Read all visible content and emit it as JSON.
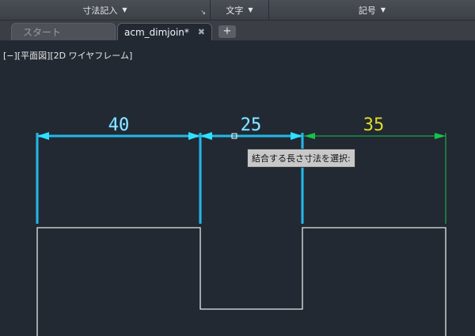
{
  "ribbon": {
    "panels": [
      {
        "label": "寸法記入",
        "has_dropdown": true,
        "has_launcher": true
      },
      {
        "label": "文字",
        "has_dropdown": true,
        "has_launcher": false
      },
      {
        "label": "記号",
        "has_dropdown": true,
        "has_launcher": false
      }
    ]
  },
  "tabs": {
    "start_label": "スタート",
    "active_label": "acm_dimjoin*",
    "close_symbol": "✖",
    "add_symbol": "+"
  },
  "viewport": {
    "label": "[−][平面図][2D ワイヤフレーム]"
  },
  "dimensions": {
    "d1": "40",
    "d2": "25",
    "d3": "35"
  },
  "tooltip": {
    "text": "結合する長さ寸法を選択:"
  },
  "colors": {
    "background": "#222932",
    "selected_dimension": "#1fa0d6",
    "dimension_green": "#17c44a",
    "dimension_text_yellow": "#e0dc2a",
    "geometry": "#e8e8e8"
  }
}
